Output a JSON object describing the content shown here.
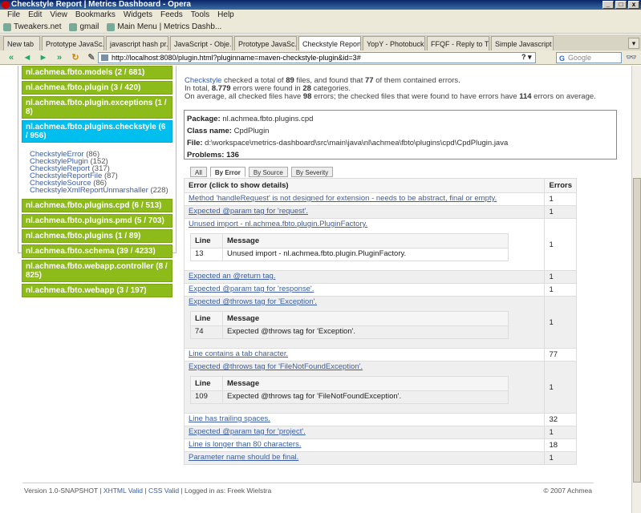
{
  "window": {
    "title": "Checkstyle Report | Metrics Dashboard - Opera"
  },
  "menu": [
    "File",
    "Edit",
    "View",
    "Bookmarks",
    "Widgets",
    "Feeds",
    "Tools",
    "Help"
  ],
  "bookmarks": [
    "Tweakers.net",
    "gmail",
    "Main Menu | Metrics Dashb..."
  ],
  "tabs": [
    {
      "label": "New tab"
    },
    {
      "label": "Prototype JavaSc..."
    },
    {
      "label": "javascript hash pr..."
    },
    {
      "label": "JavaScript - Obje..."
    },
    {
      "label": "Prototype JavaSc..."
    },
    {
      "label": "Checkstyle Report..."
    },
    {
      "label": "YopY - Photobuck..."
    },
    {
      "label": "FFQF - Reply to T..."
    },
    {
      "label": "Simple Javascript ..."
    }
  ],
  "address": {
    "url": "http://localhost:8080/plugin.html?pluginname=maven-checkstyle-plugin&id=3#",
    "search_placeholder": "Google"
  },
  "sidebar": {
    "packages_top": [
      {
        "label": "nl.achmea.fbto.models (2 / 681)"
      },
      {
        "label": "nl.achmea.fbto.plugin (3 / 420)"
      },
      {
        "label": "nl.achmea.fbto.plugin.exceptions (1 / 8)"
      },
      {
        "label": "nl.achmea.fbto.plugins.checkstyle (6 / 956)"
      }
    ],
    "classes": [
      {
        "name": "CheckstyleError",
        "count": "(86)"
      },
      {
        "name": "CheckstylePlugin",
        "count": "(152)"
      },
      {
        "name": "CheckstyleReport",
        "count": "(317)"
      },
      {
        "name": "CheckstyleReportFile",
        "count": "(87)"
      },
      {
        "name": "CheckstyleSource",
        "count": "(86)"
      },
      {
        "name": "CheckstyleXmlReportUnmarshaller",
        "count": "(228)"
      }
    ],
    "packages_bottom": [
      {
        "label": "nl.achmea.fbto.plugins.cpd (6 / 513)"
      },
      {
        "label": "nl.achmea.fbto.plugins.pmd (5 / 703)"
      },
      {
        "label": "nl.achmea.fbto.plugins (1 / 89)"
      },
      {
        "label": "nl.achmea.fbto.schema (39 / 4233)"
      },
      {
        "label": "nl.achmea.fbto.webapp.controller (8 / 825)"
      },
      {
        "label": "nl.achmea.fbto.webapp (3 / 197)"
      }
    ]
  },
  "summary": {
    "link": "Checkstyle",
    "line1_a": " checked a total of ",
    "files": "89",
    "line1_b": " files, and found that ",
    "error_files": "77",
    "line1_c": " of them contained errors.",
    "line2_a": "In total, ",
    "errors": "8.779",
    "line2_b": " errors were found in ",
    "categories": "28",
    "line2_c": " categories.",
    "line3_a": "On average, all checked files have ",
    "avg_all": "98",
    "line3_b": " errors; the checked files that were found to have errors have ",
    "avg_err": "114",
    "line3_c": " errors on average."
  },
  "info": {
    "package_label": "Package:",
    "package": "nl.achmea.fbto.plugins.cpd",
    "class_label": "Class name:",
    "class": "CpdPlugin",
    "file_label": "File:",
    "file": "d:\\workspace\\metrics-dashboard\\src\\main\\java\\nl\\achmea\\fbto\\plugins\\cpd\\CpdPlugin.java",
    "problems_label": "Problems:",
    "problems": "136"
  },
  "subtabs": [
    "All",
    "By Error",
    "By Source",
    "By Severity"
  ],
  "table": {
    "col_error": "Error (click to show details)",
    "col_errors": "Errors",
    "detail_line": "Line",
    "detail_message": "Message",
    "rows": [
      {
        "text": "Method 'handleRequest' is not designed for extension - needs to be abstract, final or empty.",
        "count": "1"
      },
      {
        "text": "Expected @param tag for 'request'.",
        "count": "1"
      },
      {
        "text": "Unused import - nl.achmea.fbto.plugin.PluginFactory.",
        "count": "1",
        "detail": {
          "line": "13",
          "message": "Unused import - nl.achmea.fbto.plugin.PluginFactory."
        }
      },
      {
        "text": "Expected an @return tag.",
        "count": "1"
      },
      {
        "text": "Expected @param tag for 'response'.",
        "count": "1"
      },
      {
        "text": "Expected @throws tag for 'Exception'.",
        "count": "1",
        "detail": {
          "line": "74",
          "message": "Expected @throws tag for 'Exception'."
        }
      },
      {
        "text": "Line contains a tab character.",
        "count": "77"
      },
      {
        "text": "Expected @throws tag for 'FileNotFoundException'.",
        "count": "1",
        "detail": {
          "line": "109",
          "message": "Expected @throws tag for 'FileNotFoundException'."
        }
      },
      {
        "text": "Line has trailing spaces.",
        "count": "32"
      },
      {
        "text": "Expected @param tag for 'project'.",
        "count": "1"
      },
      {
        "text": "Line is longer than 80 characters.",
        "count": "18"
      },
      {
        "text": "Parameter name should be final.",
        "count": "1"
      }
    ]
  },
  "footer": {
    "version": "Version 1.0-SNAPSHOT",
    "xhtml": "XHTML Valid",
    "css": "CSS Valid",
    "logged": "Logged in as: Freek Wielstra",
    "copyright": "© 2007 Achmea"
  },
  "colors": {
    "package_bg": "#8dbb1a",
    "selected_package_bg": "#00bfef",
    "link": "#3b5ea3"
  }
}
